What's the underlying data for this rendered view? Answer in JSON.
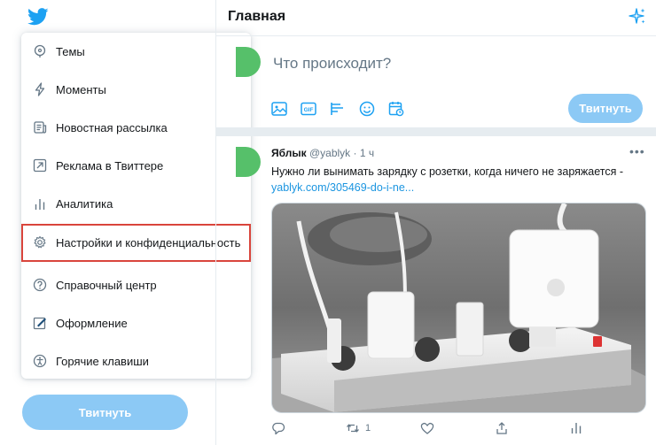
{
  "sidebar": {
    "menu": [
      {
        "label": "Темы",
        "icon": "topics-icon"
      },
      {
        "label": "Моменты",
        "icon": "lightning-icon"
      },
      {
        "label": "Новостная рассылка",
        "icon": "newsletter-icon"
      },
      {
        "label": "Реклама в Твиттере",
        "icon": "ads-arrow-icon"
      },
      {
        "label": "Аналитика",
        "icon": "analytics-icon"
      },
      {
        "label": "Настройки и конфиденциальность",
        "icon": "gear-icon",
        "highlighted": true
      },
      {
        "label": "Справочный центр",
        "icon": "help-icon"
      },
      {
        "label": "Оформление",
        "icon": "display-icon"
      },
      {
        "label": "Горячие клавиши",
        "icon": "accessibility-icon"
      }
    ],
    "tweet_button": "Твитнуть"
  },
  "main": {
    "title": "Главная",
    "compose": {
      "placeholder": "Что происходит?",
      "tweet_button": "Твитнуть",
      "tools": [
        "image-icon",
        "gif-icon",
        "poll-icon",
        "emoji-icon",
        "schedule-icon"
      ]
    },
    "tweet": {
      "author": "Яблык",
      "handle": "@yablyk",
      "sep": "·",
      "time": "1 ч",
      "text": "Нужно ли вынимать зарядку с розетки, когда ничего не заряжается -",
      "link": "yablyk.com/305469-do-i-ne...",
      "retweets": "1"
    }
  },
  "colors": {
    "accent": "#1da1f2",
    "button_disabled": "#8cc9f5",
    "highlight": "#d9453c",
    "avatar": "#56c06a"
  }
}
